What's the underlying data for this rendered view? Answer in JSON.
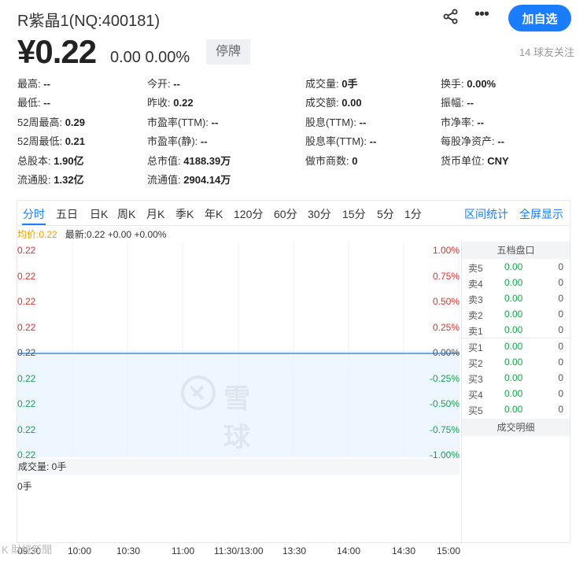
{
  "header": {
    "stock_name": "R紫晶1(NQ:400181)",
    "add_label": "加自选",
    "icons": {
      "share": "share-icon",
      "more": "more-icon"
    }
  },
  "price": {
    "current": "¥0.22",
    "change": "0.00 0.00%",
    "status": "停牌",
    "followers": "14 球友关注"
  },
  "quote": {
    "items": [
      {
        "label": "最高:",
        "value": "--"
      },
      {
        "label": "今开:",
        "value": "--"
      },
      {
        "label": "成交量:",
        "value": "0手"
      },
      {
        "label": "换手:",
        "value": "0.00%"
      },
      {
        "label": "最低:",
        "value": "--"
      },
      {
        "label": "昨收:",
        "value": "0.22"
      },
      {
        "label": "成交额:",
        "value": "0.00"
      },
      {
        "label": "振幅:",
        "value": "--"
      },
      {
        "label": "52周最高:",
        "value": "0.29"
      },
      {
        "label": "市盈率(TTM):",
        "value": "--"
      },
      {
        "label": "股息(TTM):",
        "value": "--"
      },
      {
        "label": "市净率:",
        "value": "--"
      },
      {
        "label": "52周最低:",
        "value": "0.21"
      },
      {
        "label": "市盈率(静):",
        "value": "--"
      },
      {
        "label": "股息率(TTM):",
        "value": "--"
      },
      {
        "label": "每股净资产:",
        "value": "--"
      },
      {
        "label": "总股本:",
        "value": "1.90亿"
      },
      {
        "label": "总市值:",
        "value": "4188.39万"
      },
      {
        "label": "做市商数:",
        "value": "0"
      },
      {
        "label": "货币单位:",
        "value": "CNY"
      },
      {
        "label": "流通股:",
        "value": "1.32亿"
      },
      {
        "label": "流通值:",
        "value": "2904.14万"
      }
    ]
  },
  "chart": {
    "tabs": [
      "分时",
      "五日",
      "日K",
      "周K",
      "月K",
      "季K",
      "年K",
      "120分",
      "60分",
      "30分",
      "15分",
      "5分",
      "1分"
    ],
    "active_tab": "分时",
    "right_tabs": [
      "区间统计",
      "全屏显示"
    ],
    "legend_avg": "均价:0.22",
    "legend_latest": "最新:0.22 +0.00 +0.00%",
    "volume_label": "成交量: 0手",
    "volume_zero": "0手",
    "watermark": "雪球",
    "line_color": "#4a8fd8"
  },
  "chart_data": {
    "type": "line",
    "x_ticks": [
      "09:30",
      "10:00",
      "10:30",
      "11:00",
      "11:30/13:00",
      "13:30",
      "14:00",
      "14:30",
      "15:00"
    ],
    "y_left_ticks": [
      "0.22",
      "0.22",
      "0.22",
      "0.22",
      "0.22",
      "0.22",
      "0.22",
      "0.22",
      "0.22"
    ],
    "y_right_ticks": [
      "1.00%",
      "0.75%",
      "0.50%",
      "0.25%",
      "0.00%",
      "-0.25%",
      "-0.50%",
      "-0.75%",
      "-1.00%"
    ],
    "series": [
      {
        "values": [
          0.22,
          0.22
        ]
      }
    ],
    "ylim": [
      -1.0,
      1.0
    ]
  },
  "orderbook": {
    "title": "五档盘口",
    "detail_label": "成交明细",
    "sells": [
      {
        "side": "卖5",
        "price": "0.00",
        "vol": "0"
      },
      {
        "side": "卖4",
        "price": "0.00",
        "vol": "0"
      },
      {
        "side": "卖3",
        "price": "0.00",
        "vol": "0"
      },
      {
        "side": "卖2",
        "price": "0.00",
        "vol": "0"
      },
      {
        "side": "卖1",
        "price": "0.00",
        "vol": "0"
      }
    ],
    "buys": [
      {
        "side": "买1",
        "price": "0.00",
        "vol": "0"
      },
      {
        "side": "买2",
        "price": "0.00",
        "vol": "0"
      },
      {
        "side": "买3",
        "price": "0.00",
        "vol": "0"
      },
      {
        "side": "买4",
        "price": "0.00",
        "vol": "0"
      },
      {
        "side": "买5",
        "price": "0.00",
        "vol": "0"
      }
    ]
  },
  "footer": {
    "mark": "K 財經新聞"
  }
}
